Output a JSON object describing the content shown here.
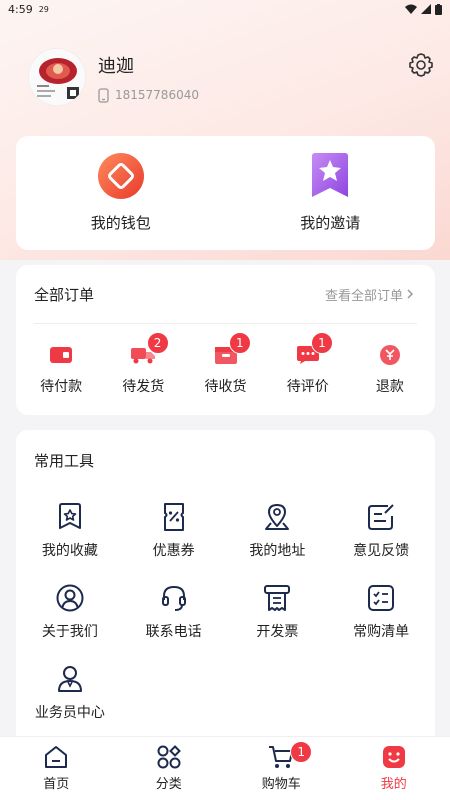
{
  "status_bar": {
    "time": "4:59",
    "extra": "29"
  },
  "profile": {
    "name": "迪迦",
    "phone": "18157786040"
  },
  "wallet": {
    "items": [
      {
        "label": "我的钱包",
        "icon": "wallet-icon"
      },
      {
        "label": "我的邀请",
        "icon": "invite-icon"
      }
    ]
  },
  "orders": {
    "title": "全部订单",
    "view_all": "查看全部订单",
    "items": [
      {
        "label": "待付款",
        "icon": "wallet-card-icon",
        "badge": ""
      },
      {
        "label": "待发货",
        "icon": "truck-icon",
        "badge": "2"
      },
      {
        "label": "待收货",
        "icon": "package-icon",
        "badge": "1"
      },
      {
        "label": "待评价",
        "icon": "comment-icon",
        "badge": "1"
      },
      {
        "label": "退款",
        "icon": "refund-icon",
        "badge": ""
      }
    ]
  },
  "tools": {
    "title": "常用工具",
    "items": [
      {
        "label": "我的收藏",
        "icon": "favorite-icon"
      },
      {
        "label": "优惠券",
        "icon": "coupon-icon"
      },
      {
        "label": "我的地址",
        "icon": "location-icon"
      },
      {
        "label": "意见反馈",
        "icon": "feedback-icon"
      },
      {
        "label": "关于我们",
        "icon": "user-circle-icon"
      },
      {
        "label": "联系电话",
        "icon": "headset-icon"
      },
      {
        "label": "开发票",
        "icon": "invoice-icon"
      },
      {
        "label": "常购清单",
        "icon": "checklist-icon"
      },
      {
        "label": "业务员中心",
        "icon": "salesman-icon"
      }
    ]
  },
  "tabbar": {
    "items": [
      {
        "label": "首页",
        "icon": "home-icon",
        "badge": ""
      },
      {
        "label": "分类",
        "icon": "category-icon",
        "badge": ""
      },
      {
        "label": "购物车",
        "icon": "cart-icon",
        "badge": "1"
      },
      {
        "label": "我的",
        "icon": "mine-icon",
        "badge": ""
      }
    ],
    "active": "我的"
  },
  "colors": {
    "accent": "#ef3a45",
    "badge": "#ef3a45",
    "navy": "#1d2a4d"
  }
}
